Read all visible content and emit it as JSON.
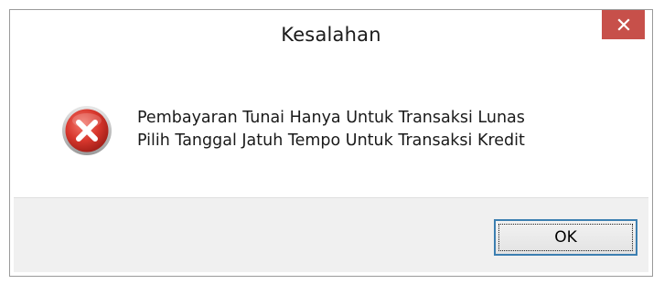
{
  "window": {
    "title": "Kesalahan"
  },
  "title_bar": {
    "close_icon": "close-icon"
  },
  "message": {
    "icon": "error-icon",
    "line1": "Pembayaran Tunai Hanya Untuk Transaksi Lunas",
    "line2": "Pilih Tanggal Jatuh Tempo Untuk Transaksi Kredit"
  },
  "buttons": {
    "ok_label": "OK"
  },
  "colors": {
    "close_button": "#c7504a",
    "error_icon": "#c0302a",
    "footer_bg": "#f0f0f0",
    "button_border": "#3c7fb1"
  }
}
